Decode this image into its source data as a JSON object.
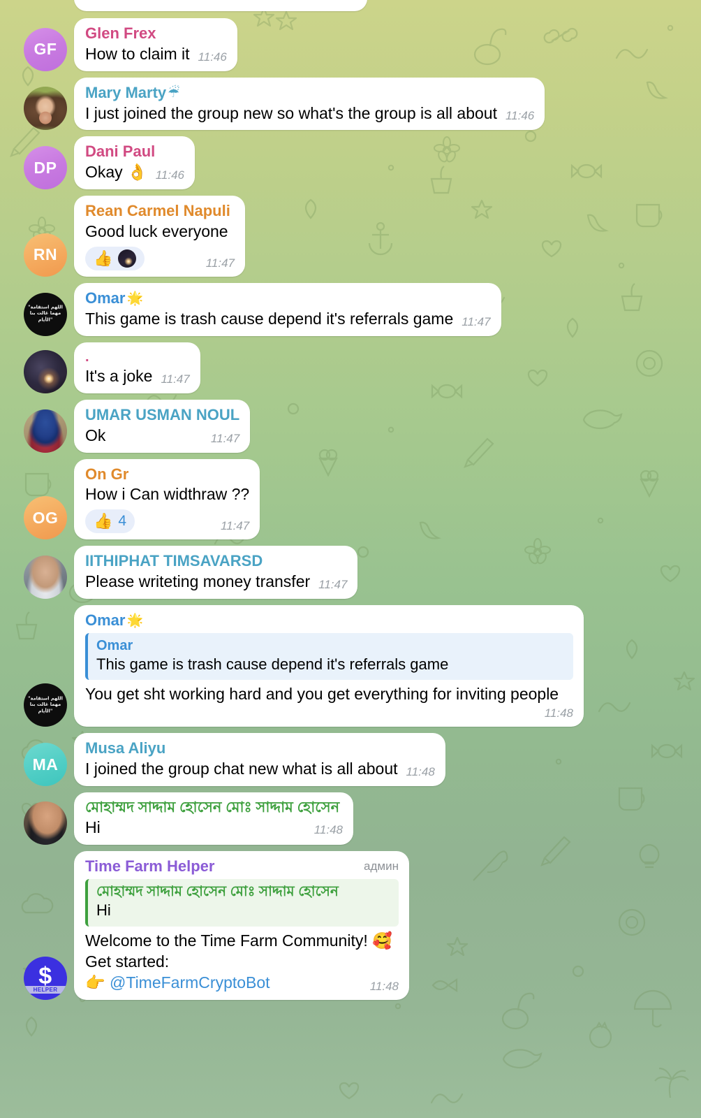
{
  "app": {
    "name": "Telegram",
    "screen": "group-chat",
    "background_colors": {
      "top": "#ccd48a",
      "middle": "#99c290",
      "bottom": "#9cbd9b",
      "doodle_stroke": "#7d9a63"
    },
    "accent_colors": {
      "bubble": "#ffffff",
      "quote_blue": "#3a8fd6",
      "quote_blue_bg": "#e9f2fb",
      "quote_green": "#3ea03e",
      "quote_green_bg": "#edf6ea",
      "reaction_bg": "#e8eefa",
      "time": "#9aa0a6"
    }
  },
  "messages": [
    {
      "id": "m0",
      "partial": true,
      "avatar": {
        "type": "color",
        "initials": "",
        "style": "av-blue"
      },
      "sender": "",
      "text": "",
      "time": ""
    },
    {
      "id": "m1",
      "avatar": {
        "type": "initials",
        "initials": "GF",
        "style": "av-purple"
      },
      "sender": "Glen Frex",
      "sender_color": "c-pink",
      "text": "How to claim it",
      "time": "11:46"
    },
    {
      "id": "m2",
      "avatar": {
        "type": "photo",
        "initials": "",
        "style": "av-photo-mary"
      },
      "sender": "Mary Marty",
      "sender_emoji": "☔",
      "sender_color": "c-cyan",
      "text": "I just joined the group new so what's the group is all about",
      "time": "11:46"
    },
    {
      "id": "m3",
      "avatar": {
        "type": "initials",
        "initials": "DP",
        "style": "av-purple"
      },
      "sender": "Dani Paul",
      "sender_color": "c-pink",
      "text": "Okay 👌",
      "time": "11:46"
    },
    {
      "id": "m4",
      "avatar": {
        "type": "initials",
        "initials": "RN",
        "style": "av-orange"
      },
      "sender": "Rean Carmel Napuli",
      "sender_color": "c-orange",
      "text": "Good luck everyone",
      "time": "11:47",
      "reactions": [
        {
          "emoji": "👍",
          "count": "",
          "show_avatar": true
        }
      ]
    },
    {
      "id": "m5",
      "avatar": {
        "type": "arabic",
        "initials": "",
        "style": "av-dark",
        "arabic_text": "\"اللهم استقامة مهما غالت بنا الأيام\""
      },
      "sender": "Omar",
      "sender_emoji": "🌟",
      "sender_color": "c-blue",
      "verified": true,
      "text": "This game is trash cause depend it's referrals game",
      "time": "11:47"
    },
    {
      "id": "m6",
      "avatar": {
        "type": "photo",
        "initials": "",
        "style": "av-photo-space"
      },
      "sender": ".",
      "sender_color": "c-pink",
      "text": "It's a joke",
      "time": "11:47"
    },
    {
      "id": "m7",
      "avatar": {
        "type": "photo",
        "initials": "",
        "style": "av-photo-umar"
      },
      "sender": "UMAR USMAN NOUL",
      "sender_color": "c-cyan",
      "text": "Ok",
      "time": "11:47"
    },
    {
      "id": "m8",
      "avatar": {
        "type": "initials",
        "initials": "OG",
        "style": "av-orange"
      },
      "sender": "On Gr",
      "sender_color": "c-orange",
      "text": "How i Can widthraw ??",
      "time": "11:47",
      "reactions": [
        {
          "emoji": "👍",
          "count": "4",
          "show_avatar": false
        }
      ]
    },
    {
      "id": "m9",
      "avatar": {
        "type": "photo",
        "initials": "",
        "style": "av-photo-iith"
      },
      "sender": "IITHIPHAT TIMSAVARSD",
      "sender_color": "c-cyan",
      "text": "Please writeting money transfer",
      "time": "11:47"
    },
    {
      "id": "m10",
      "avatar": {
        "type": "arabic",
        "initials": "",
        "style": "av-dark",
        "arabic_text": "\"اللهم استقامة مهما غالت بنا الأيام\""
      },
      "sender": "Omar",
      "sender_emoji": "🌟",
      "sender_color": "c-blue",
      "verified": true,
      "quote": {
        "author": "Omar",
        "text": "This game is trash cause depend it's referrals game",
        "color": "blue"
      },
      "text": "You get sht working hard and you get everything for inviting people",
      "time": "11:48",
      "time_on_own_line": true
    },
    {
      "id": "m11",
      "avatar": {
        "type": "initials",
        "initials": "MA",
        "style": "av-teal"
      },
      "sender": "Musa Aliyu",
      "sender_color": "c-cyan",
      "text": "I joined the group  chat new what is all about",
      "time": "11:48"
    },
    {
      "id": "m12",
      "avatar": {
        "type": "photo",
        "initials": "",
        "style": "av-photo-saddam"
      },
      "sender": "মোহাম্মদ সাদ্দাম হোসেন মোঃ সাদ্দাম হোসেন",
      "sender_color": "c-green",
      "text": "Hi",
      "time": "11:48"
    },
    {
      "id": "m13",
      "avatar": {
        "type": "helper",
        "initials": "$",
        "style": "av-blue",
        "badge": "HELPER"
      },
      "sender": "Time Farm Helper",
      "sender_color": "c-purple",
      "admin_label": "админ",
      "quote": {
        "author": "মোহাম্মদ সাদ্দাম হোসেন মোঃ সাদ্দাম হোসেন",
        "text": "Hi",
        "color": "green"
      },
      "text_lines": [
        "Welcome to the Time Farm Community! 🥰",
        "Get started:",
        "👉 @TimeFarmCryptoBot"
      ],
      "link_text": "@TimeFarmCryptoBot",
      "time": "11:48"
    }
  ]
}
